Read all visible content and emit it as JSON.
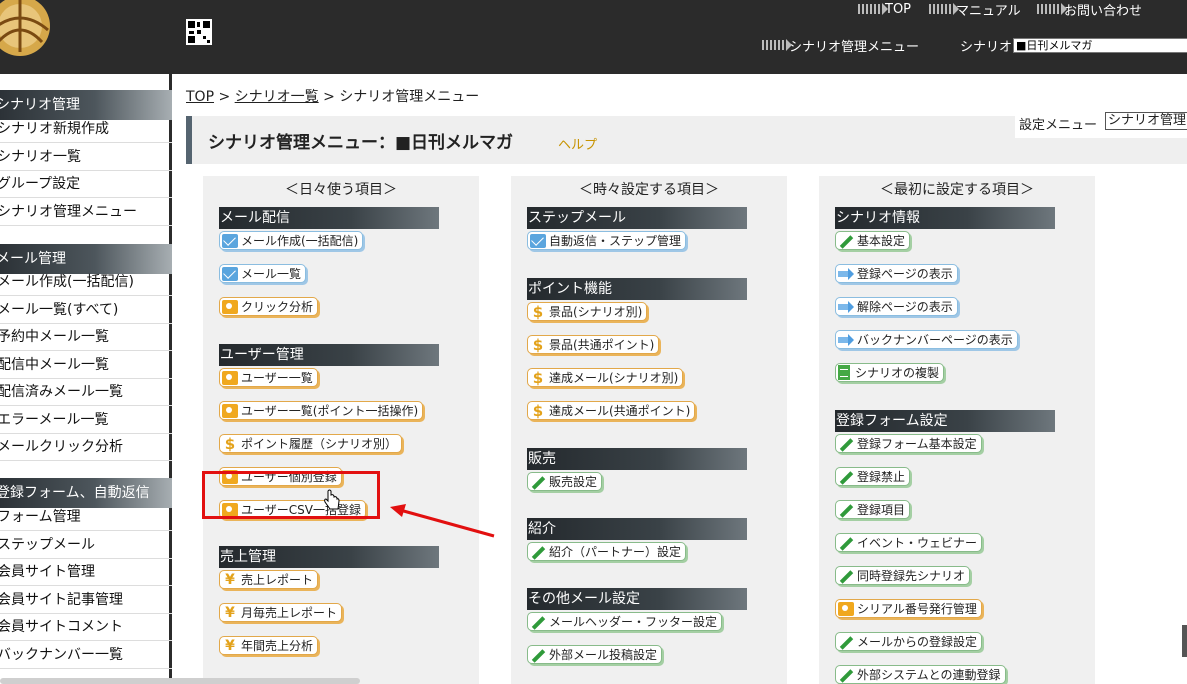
{
  "header": {
    "links": [
      "TOP",
      "マニュアル",
      "お問い合わせ"
    ],
    "scenario_menu_label": "シナリオ管理メニュー",
    "scenario_label": "シナリオ",
    "scenario_selected": "■日刊メルマガ"
  },
  "sidebar": {
    "sections": [
      {
        "title": "シナリオ管理",
        "items": [
          "シナリオ新規作成",
          "シナリオ一覧",
          "グループ設定",
          "シナリオ管理メニュー"
        ]
      },
      {
        "title": "メール管理",
        "items": [
          "メール作成(一括配信)",
          "メール一覧(すべて)",
          "予約中メール一覧",
          "配信中メール一覧",
          "配信済みメール一覧",
          "エラーメール一覧",
          "メールクリック分析"
        ]
      },
      {
        "title": "登録フォーム、自動返信",
        "items": [
          "フォーム管理",
          "ステップメール",
          "会員サイト管理",
          "会員サイト記事管理",
          "会員サイトコメント",
          "バックナンバー一覧"
        ]
      }
    ]
  },
  "breadcrumb": {
    "top": "TOP",
    "sep": ">",
    "list": "シナリオ一覧",
    "current": "シナリオ管理メニュー"
  },
  "title": {
    "text": "シナリオ管理メニュー：■日刊メルマガ",
    "help": "ヘルプ"
  },
  "settings_menu": {
    "label": "設定メニュー",
    "selected": "シナリオ管理"
  },
  "columns": [
    {
      "title": "＜日々使う項目＞",
      "sections": [
        {
          "title": "メール配信",
          "items": [
            {
              "label": "メール作成(一括配信)",
              "icon": "mail-icon"
            },
            {
              "label": "メール一覧",
              "icon": "mail-icon"
            },
            {
              "label": "クリック分析",
              "icon": "user-icon"
            }
          ]
        },
        {
          "title": "ユーザー管理",
          "items": [
            {
              "label": "ユーザー一覧",
              "icon": "user-icon"
            },
            {
              "label": "ユーザー一覧(ポイント一括操作)",
              "icon": "user-icon"
            },
            {
              "label": "ポイント履歴（シナリオ別）",
              "icon": "dollar-icon"
            },
            {
              "label": "ユーザー個別登録",
              "icon": "user-icon"
            },
            {
              "label": "ユーザーCSV一括登録",
              "icon": "user-icon"
            }
          ]
        },
        {
          "title": "売上管理",
          "items": [
            {
              "label": "売上レポート",
              "icon": "yen-icon"
            },
            {
              "label": "月毎売上レポート",
              "icon": "yen-icon"
            },
            {
              "label": "年間売上分析",
              "icon": "yen-icon"
            }
          ]
        }
      ]
    },
    {
      "title": "＜時々設定する項目＞",
      "sections": [
        {
          "title": "ステップメール",
          "items": [
            {
              "label": "自動返信・ステップ管理",
              "icon": "mail-icon"
            }
          ]
        },
        {
          "title": "ポイント機能",
          "items": [
            {
              "label": "景品(シナリオ別)",
              "icon": "dollar-icon"
            },
            {
              "label": "景品(共通ポイント)",
              "icon": "dollar-icon"
            },
            {
              "label": "達成メール(シナリオ別)",
              "icon": "dollar-icon"
            },
            {
              "label": "達成メール(共通ポイント)",
              "icon": "dollar-icon"
            }
          ]
        },
        {
          "title": "販売",
          "items": [
            {
              "label": "販売設定",
              "icon": "pencil-icon"
            }
          ]
        },
        {
          "title": "紹介",
          "items": [
            {
              "label": "紹介（パートナー）設定",
              "icon": "pencil-icon"
            }
          ]
        },
        {
          "title": "その他メール設定",
          "items": [
            {
              "label": "メールヘッダー・フッター設定",
              "icon": "pencil-icon"
            },
            {
              "label": "外部メール投稿設定",
              "icon": "pencil-icon"
            }
          ]
        }
      ]
    },
    {
      "title": "＜最初に設定する項目＞",
      "sections": [
        {
          "title": "シナリオ情報",
          "items": [
            {
              "label": "基本設定",
              "icon": "pencil-icon"
            },
            {
              "label": "登録ページの表示",
              "icon": "arrow-icon"
            },
            {
              "label": "解除ページの表示",
              "icon": "arrow-icon"
            },
            {
              "label": "バックナンバーページの表示",
              "icon": "arrow-icon"
            },
            {
              "label": "シナリオの複製",
              "icon": "document-icon"
            }
          ]
        },
        {
          "title": "登録フォーム設定",
          "items": [
            {
              "label": "登録フォーム基本設定",
              "icon": "pencil-icon"
            },
            {
              "label": "登録禁止",
              "icon": "pencil-icon"
            },
            {
              "label": "登録項目",
              "icon": "pencil-icon"
            },
            {
              "label": "イベント・ウェビナー",
              "icon": "pencil-icon"
            },
            {
              "label": "同時登録先シナリオ",
              "icon": "pencil-icon"
            },
            {
              "label": "シリアル番号発行管理",
              "icon": "user-icon"
            },
            {
              "label": "メールからの登録設定",
              "icon": "pencil-icon"
            },
            {
              "label": "外部システムとの連動登録",
              "icon": "pencil-icon"
            }
          ]
        }
      ]
    }
  ],
  "colors": {
    "header_bg": "#2b2b2b",
    "accent_gold": "#c79300",
    "highlight_red": "#e21010"
  }
}
